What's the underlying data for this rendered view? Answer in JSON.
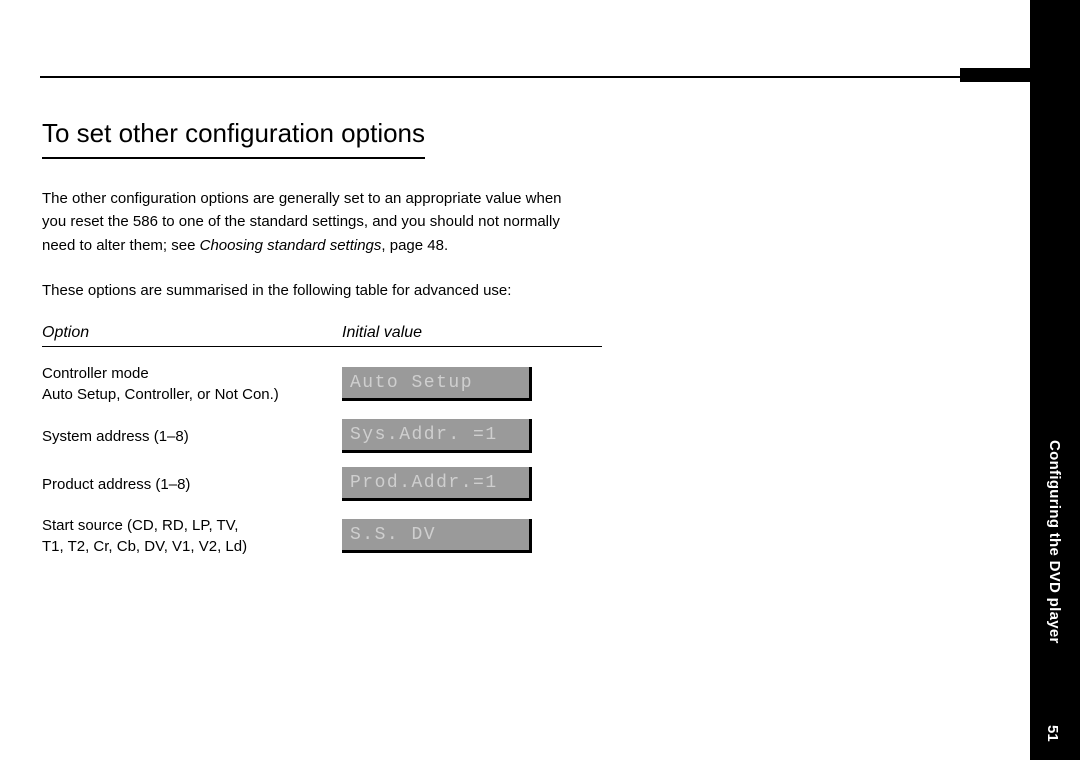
{
  "sidebar": {
    "section_label": "Configuring the DVD player",
    "page_number": "51"
  },
  "main": {
    "title": "To set other configuration options",
    "para1_part1": "The other configuration options are generally set to an appropriate value when you reset the 586 to one of the standard settings, and you should not normally need to alter them; see ",
    "para1_ital": "Choosing standard settings",
    "para1_part2": ", page 48.",
    "para2": "These options are summarised in the following table for advanced use:",
    "table": {
      "head_option": "Option",
      "head_initial": "Initial value",
      "rows": [
        {
          "label_line1": "Controller mode",
          "label_line2": "Auto Setup, Controller, or Not Con.)",
          "lcd": "Auto Setup"
        },
        {
          "label_line1": "System address (1–8)",
          "label_line2": "",
          "lcd": "Sys.Addr. =1"
        },
        {
          "label_line1": "Product address (1–8)",
          "label_line2": "",
          "lcd": "Prod.Addr.=1"
        },
        {
          "label_line1": "Start source (CD, RD, LP, TV,",
          "label_line2": "T1, T2, Cr, Cb, DV, V1, V2, Ld)",
          "lcd": "S.S.  DV"
        }
      ]
    }
  }
}
